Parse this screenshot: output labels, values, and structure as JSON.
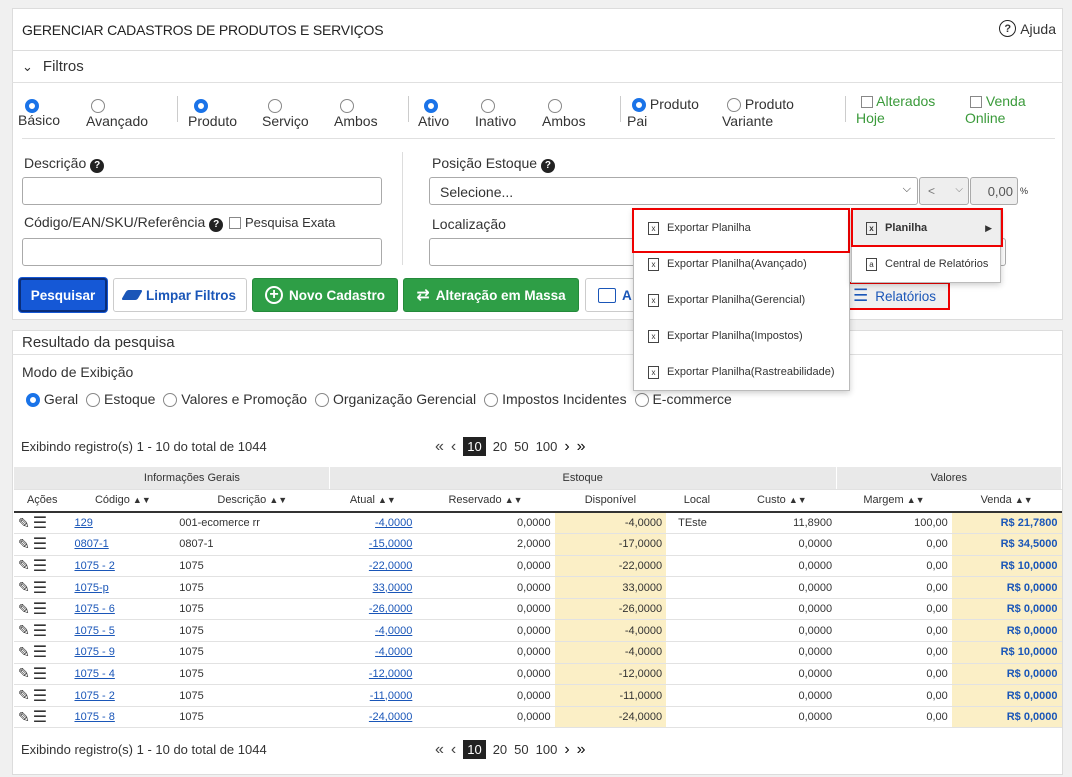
{
  "header": {
    "title": "GERENCIAR CADASTROS DE PRODUTOS E SERVIÇOS",
    "help": "Ajuda"
  },
  "filters": {
    "title": "Filtros",
    "mode": [
      "Básico",
      "Avançado"
    ],
    "kind": [
      "Produto",
      "Serviço",
      "Ambos"
    ],
    "status": [
      "Ativo",
      "Inativo",
      "Ambos"
    ],
    "product_pai": [
      "Produto",
      "Pai"
    ],
    "product_variant": [
      "Produto",
      "Variante"
    ],
    "changed_today": [
      "Alterados",
      "Hoje"
    ],
    "online_sale": [
      "Venda",
      "Online"
    ],
    "description_label": "Descrição",
    "code_label": "Código/EAN/SKU/Referência",
    "exact_search": "Pesquisa Exata",
    "stock_position_label": "Posição Estoque",
    "stock_select": "Selecione...",
    "operator": "<",
    "stock_value": "0,00",
    "percent": "%",
    "location_label": "Localização"
  },
  "buttons": {
    "search": "Pesquisar",
    "clear": "Limpar Filtros",
    "new": "Novo Cadastro",
    "bulk": "Alteração em Massa",
    "partial": "A",
    "reports": "Relatórios"
  },
  "export_menu": [
    "Exportar Planilha",
    "Exportar Planilha(Avançado)",
    "Exportar Planilha(Gerencial)",
    "Exportar Planilha(Impostos)",
    "Exportar Planilha(Rastreabilidade)"
  ],
  "reports_menu": [
    "Planilha",
    "Central de Relatórios"
  ],
  "results": {
    "title": "Resultado da pesquisa",
    "view_mode_label": "Modo de Exibição",
    "view_modes": [
      "Geral",
      "Estoque",
      "Valores e Promoção",
      "Organização Gerencial",
      "Impostos Incidentes",
      "E-commerce"
    ],
    "showing": "Exibindo registro(s) 1 - 10 do total de 1044",
    "page_sizes": [
      "10",
      "20",
      "50",
      "100"
    ]
  },
  "table": {
    "groups": [
      "Informações Gerais",
      "Estoque",
      "Valores"
    ],
    "columns": [
      "Ações",
      "Código",
      "Descrição",
      "Atual",
      "Reservado",
      "Disponível",
      "Local",
      "Custo",
      "Margem",
      "Venda"
    ],
    "rows": [
      [
        "129",
        "001-ecomerce rr",
        "-4,0000",
        "0,0000",
        "-4,0000",
        "TEste",
        "11,8900",
        "100,00",
        "R$ 21,7800"
      ],
      [
        "0807-1",
        "0807-1",
        "-15,0000",
        "2,0000",
        "-17,0000",
        "",
        "0,0000",
        "0,00",
        "R$ 34,5000"
      ],
      [
        "1075 - 2",
        "1075",
        "-22,0000",
        "0,0000",
        "-22,0000",
        "",
        "0,0000",
        "0,00",
        "R$ 10,0000"
      ],
      [
        "1075-p",
        "1075",
        "33,0000",
        "0,0000",
        "33,0000",
        "",
        "0,0000",
        "0,00",
        "R$ 0,0000"
      ],
      [
        "1075 - 6",
        "1075",
        "-26,0000",
        "0,0000",
        "-26,0000",
        "",
        "0,0000",
        "0,00",
        "R$ 0,0000"
      ],
      [
        "1075 - 5",
        "1075",
        "-4,0000",
        "0,0000",
        "-4,0000",
        "",
        "0,0000",
        "0,00",
        "R$ 0,0000"
      ],
      [
        "1075 - 9",
        "1075",
        "-4,0000",
        "0,0000",
        "-4,0000",
        "",
        "0,0000",
        "0,00",
        "R$ 10,0000"
      ],
      [
        "1075 - 4",
        "1075",
        "-12,0000",
        "0,0000",
        "-12,0000",
        "",
        "0,0000",
        "0,00",
        "R$ 0,0000"
      ],
      [
        "1075 - 2",
        "1075",
        "-11,0000",
        "0,0000",
        "-11,0000",
        "",
        "0,0000",
        "0,00",
        "R$ 0,0000"
      ],
      [
        "1075 - 8",
        "1075",
        "-24,0000",
        "0,0000",
        "-24,0000",
        "",
        "0,0000",
        "0,00",
        "R$ 0,0000"
      ]
    ]
  },
  "colors": {
    "primary": "#1a73e8",
    "green": "#2e9e46",
    "highlight": "#fbefc6",
    "link": "#1a56b8",
    "annotation": "#ee0000"
  }
}
